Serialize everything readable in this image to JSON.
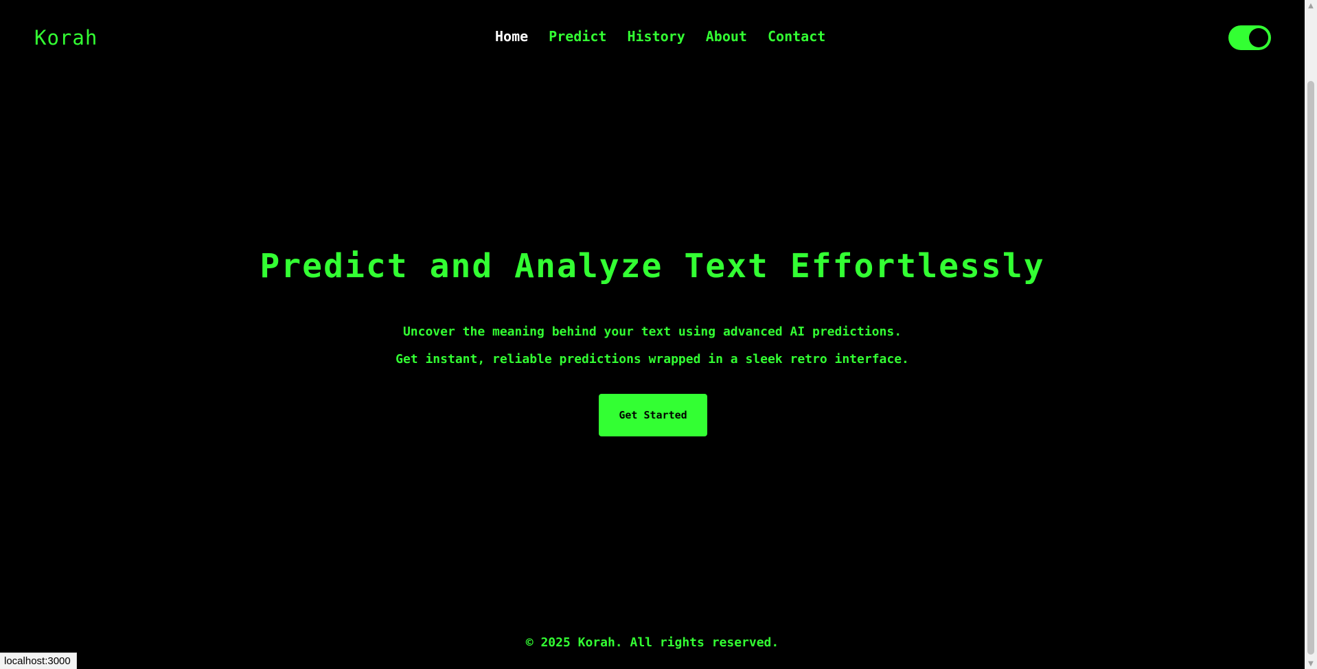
{
  "header": {
    "logo": "Korah",
    "nav": [
      {
        "label": "Home",
        "active": true
      },
      {
        "label": "Predict",
        "active": false
      },
      {
        "label": "History",
        "active": false
      },
      {
        "label": "About",
        "active": false
      },
      {
        "label": "Contact",
        "active": false
      }
    ],
    "theme_toggle": {
      "state": "on"
    }
  },
  "hero": {
    "title": "Predict and Analyze Text Effortlessly",
    "subtitle_line1": "Uncover the meaning behind your text using advanced AI predictions.",
    "subtitle_line2": "Get instant, reliable predictions wrapped in a sleek retro interface.",
    "cta_label": "Get Started"
  },
  "footer": {
    "text": "© 2025 Korah. All rights reserved."
  },
  "status_bar": {
    "url": "localhost:3000"
  },
  "colors": {
    "background": "#000000",
    "accent": "#33ff33",
    "active_nav": "#ffffff"
  }
}
